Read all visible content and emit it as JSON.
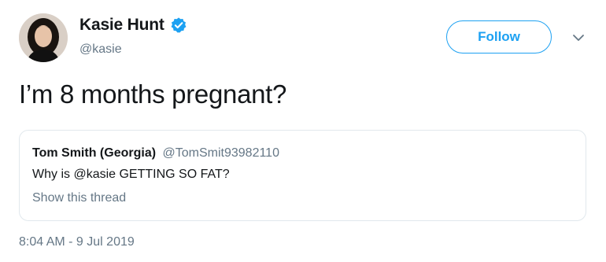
{
  "author": {
    "name": "Kasie Hunt",
    "handle": "@kasie",
    "verified": true
  },
  "header": {
    "follow_label": "Follow"
  },
  "tweet": {
    "text": "I’m 8 months pregnant?",
    "timestamp": "8:04 AM - 9 Jul 2019"
  },
  "quote": {
    "author_name": "Tom Smith (Georgia)",
    "author_handle": "@TomSmit93982110",
    "text": "Why is @kasie GETTING SO FAT?",
    "thread_link": "Show this thread"
  },
  "icons": {
    "verified": "verified-badge-icon",
    "caret": "chevron-down-icon"
  },
  "colors": {
    "accent": "#1da1f2",
    "text_primary": "#14171a",
    "text_secondary": "#657786",
    "border": "#e1e8ed"
  }
}
